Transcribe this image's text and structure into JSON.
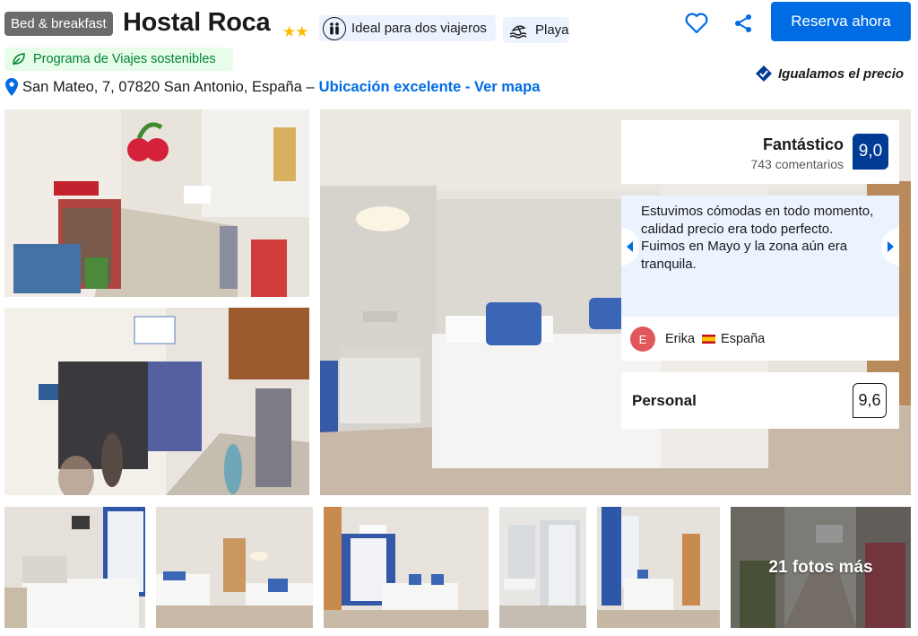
{
  "header": {
    "property_type": "Bed & breakfast",
    "hotel_name": "Hostal Roca",
    "stars": "★★",
    "travelers_chip": "Ideal para dos viajeros",
    "beach_chip": "Playa",
    "reserve_label": "Reserva ahora",
    "sustainability": "Programa de Viajes sostenibles",
    "price_match": "Igualamos el precio"
  },
  "address": {
    "text": "San Mateo, 7, 07820 San Antonio, España –",
    "location_link": "Ubicación excelente - Ver mapa"
  },
  "review_summary": {
    "rating_word": "Fantástico",
    "review_count": "743 comentarios",
    "score": "9,0"
  },
  "featured_review": {
    "quote": "Estuvimos cómodas en todo momento, calidad precio era todo perfecto. Fuimos en Mayo y la zona aún era tranquila.",
    "author_initial": "E",
    "author_name": "Erika",
    "author_country": "España"
  },
  "category_score": {
    "label": "Personal",
    "score": "9,6"
  },
  "gallery": {
    "more_photos_label": "21 fotos más"
  },
  "colors": {
    "brand_blue": "#006ce4",
    "score_navy": "#003b95",
    "sustain_green": "#008234",
    "star_yellow": "#febb02"
  },
  "icons": [
    "travelers-icon",
    "beach-icon",
    "heart-icon",
    "share-icon",
    "leaf-icon",
    "price-match-icon",
    "location-pin-icon",
    "chevron-left-icon",
    "chevron-right-icon"
  ]
}
